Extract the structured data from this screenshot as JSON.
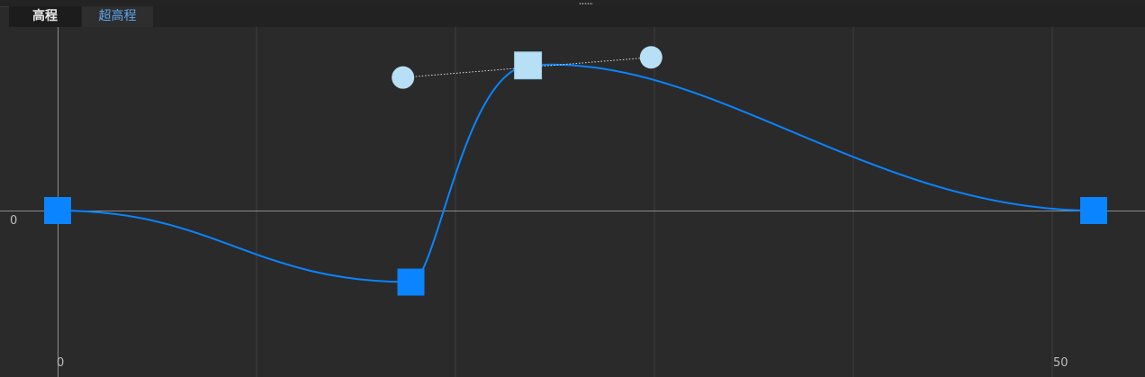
{
  "tabs": [
    {
      "label": "高程",
      "active": true
    },
    {
      "label": "超高程",
      "active": false
    }
  ],
  "y_axis_label": "0",
  "x_axis_labels": [
    "0",
    "50"
  ],
  "colors": {
    "curve": "#0a84ff",
    "key": "#0a84ff",
    "selected_key": "#b7dff5",
    "handle": "#b7dff5",
    "background": "#2a2a2a"
  },
  "chart_data": {
    "type": "line",
    "xlim": [
      0,
      52.5
    ],
    "ylim": [
      -7.4,
      8.4
    ],
    "keyframes": [
      {
        "x": 0,
        "y": 0,
        "selected": false
      },
      {
        "x": 17.8,
        "y": -3.55,
        "selected": false
      },
      {
        "x": 23.7,
        "y": 7.2,
        "selected": true
      },
      {
        "x": 52.2,
        "y": 0,
        "selected": false
      }
    ],
    "tangent_handles": [
      {
        "x": 17.4,
        "y": 6.6
      },
      {
        "x": 29.9,
        "y": 7.6
      }
    ]
  }
}
